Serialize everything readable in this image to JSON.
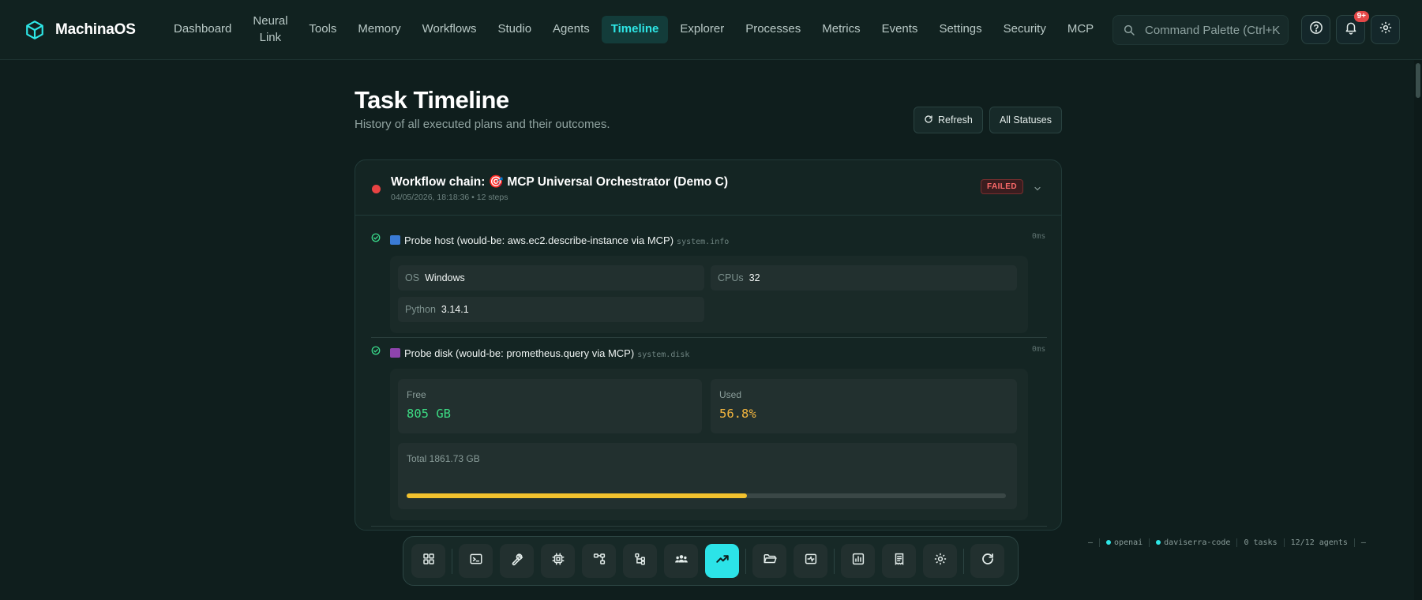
{
  "app": {
    "name": "MachinaOS"
  },
  "nav": {
    "items": [
      {
        "label": "Dashboard"
      },
      {
        "label": "Neural Link"
      },
      {
        "label": "Tools"
      },
      {
        "label": "Memory"
      },
      {
        "label": "Workflows"
      },
      {
        "label": "Studio"
      },
      {
        "label": "Agents"
      },
      {
        "label": "Timeline",
        "active": true
      },
      {
        "label": "Explorer"
      },
      {
        "label": "Processes"
      },
      {
        "label": "Metrics"
      },
      {
        "label": "Events"
      },
      {
        "label": "Settings"
      },
      {
        "label": "Security"
      },
      {
        "label": "MCP"
      }
    ]
  },
  "search": {
    "placeholder": "Command Palette (Ctrl+K"
  },
  "notifications": {
    "badge": "9+"
  },
  "header": {
    "title": "Task Timeline",
    "subtitle": "History of all executed plans and their outcomes.",
    "refresh_label": "Refresh",
    "filter_label": "All Statuses"
  },
  "task": {
    "title": "Workflow chain: 🎯 MCP Universal Orchestrator (Demo C)",
    "meta": "04/05/2026, 18:18:36 • 12 steps",
    "status": "FAILED",
    "steps": [
      {
        "title": "Probe host (would-be: aws.ec2.describe-instance via MCP)",
        "code": "system.info",
        "duration": "0ms",
        "fields": [
          {
            "key": "OS",
            "value": "Windows"
          },
          {
            "key": "CPUs",
            "value": "32"
          },
          {
            "key": "Python",
            "value": "3.14.1"
          }
        ]
      },
      {
        "title": "Probe disk (would-be: prometheus.query via MCP)",
        "code": "system.disk",
        "duration": "0ms",
        "free_label": "Free",
        "free_value": "805 GB",
        "used_label": "Used",
        "used_value": "56.8%",
        "total_label": "Total 1861.73 GB",
        "used_fraction": 0.568
      }
    ]
  },
  "statusbar": {
    "dash1": "—",
    "provider": "openai",
    "user": "daviserra-code",
    "tasks": "0 tasks",
    "agents": "12/12 agents",
    "dash2": "—"
  },
  "colors": {
    "accent": "#2ee6e6",
    "failed": "#e94343",
    "success": "#39d98a",
    "free_value": "#3ddc84",
    "used_value": "#f4b63f",
    "progress": "#f2c12e"
  }
}
